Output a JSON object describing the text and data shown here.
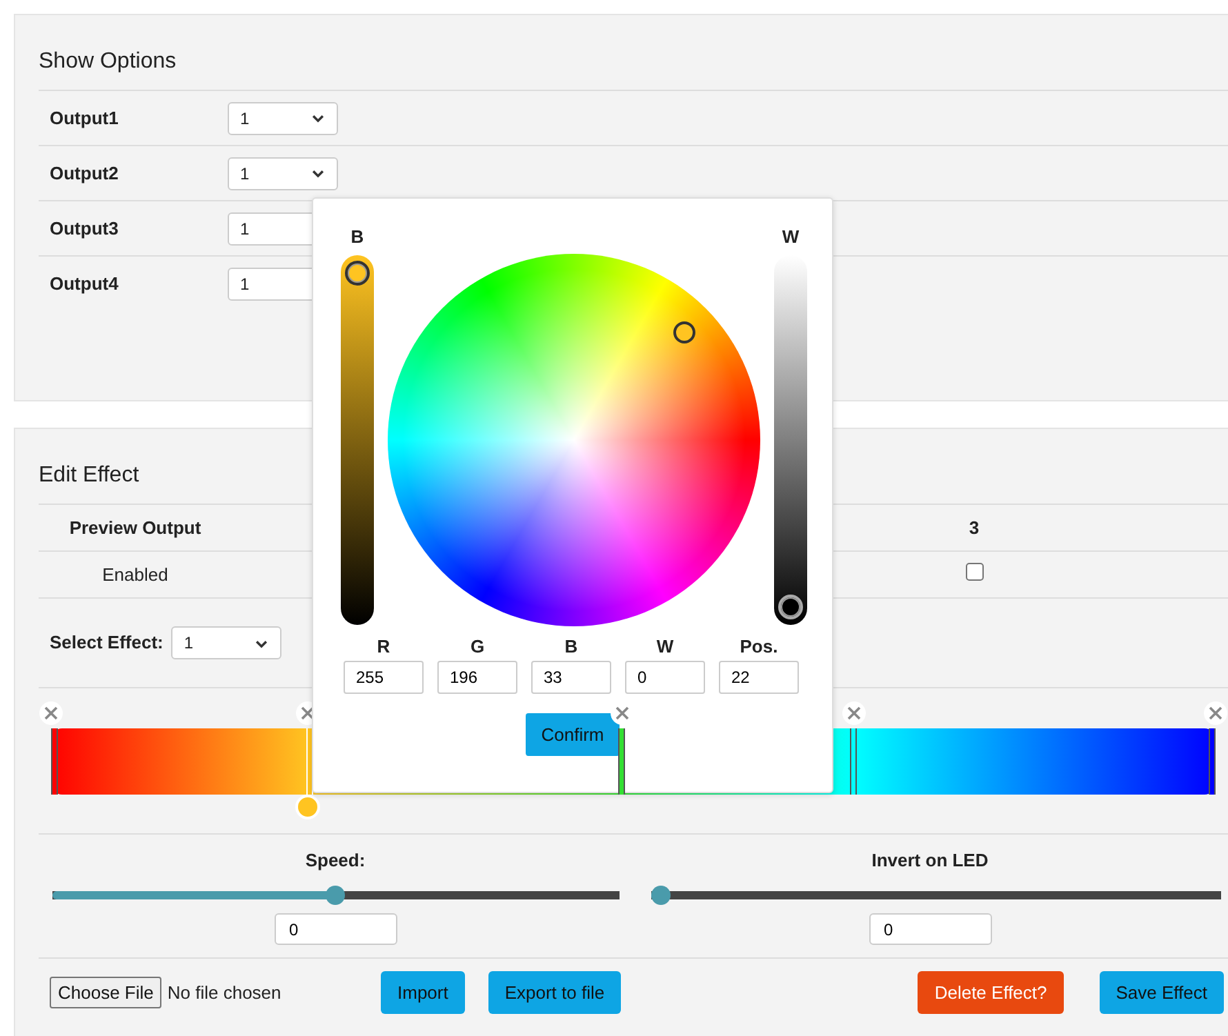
{
  "show_options": {
    "title": "Show Options",
    "outputs": [
      {
        "label": "Output1",
        "value": "1"
      },
      {
        "label": "Output2",
        "value": "1"
      },
      {
        "label": "Output3",
        "value": "1"
      },
      {
        "label": "Output4",
        "value": "1"
      }
    ]
  },
  "edit_effect": {
    "title": "Edit Effect",
    "preview_table": {
      "header_label": "Preview Output",
      "column": "3",
      "row_label": "Enabled",
      "checked": false
    },
    "select_effect": {
      "label": "Select Effect:",
      "value": "1"
    },
    "gradient_stops": [
      {
        "color": "#ff0000",
        "level": 0,
        "selected": false
      },
      {
        "color": "#ffc421",
        "level": 0.22,
        "selected": true
      },
      {
        "color": "#33e033",
        "level": 0.49,
        "selected": false
      },
      {
        "color": "#00ffff",
        "level": 0.69,
        "selected": false
      },
      {
        "color": "#0000ff",
        "level": 1,
        "selected": false
      }
    ],
    "sliders": [
      {
        "label": "Speed:",
        "level": 0.5,
        "value": "0"
      },
      {
        "label": "Invert on LED",
        "level": 0,
        "value": "0"
      }
    ],
    "file": {
      "button": "Choose File",
      "status": "No file chosen"
    },
    "buttons": [
      {
        "label": "Import",
        "kind": "primary"
      },
      {
        "label": "Export to file",
        "kind": "primary"
      },
      {
        "label": "Delete Effect?",
        "kind": "danger"
      },
      {
        "label": "Save Effect",
        "kind": "primary"
      }
    ]
  },
  "color_picker": {
    "brightness": {
      "label": "B",
      "level": 1
    },
    "white": {
      "label": "W",
      "level": 0
    },
    "fields": [
      {
        "label": "R",
        "value": "255"
      },
      {
        "label": "G",
        "value": "196"
      },
      {
        "label": "B",
        "value": "33"
      },
      {
        "label": "W",
        "value": "0"
      },
      {
        "label": "Pos.",
        "value": "22"
      }
    ],
    "confirm": "Confirm"
  }
}
